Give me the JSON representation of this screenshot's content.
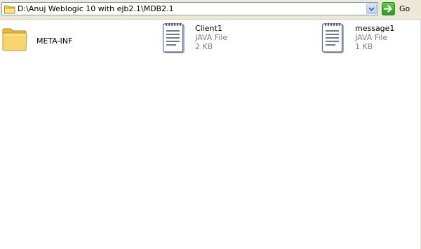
{
  "address_bar": {
    "path": "D:\\Anuj Weblogic 10 with ejb2.1\\MDB2.1",
    "go_label": "Go"
  },
  "items": [
    {
      "name": "META-INF",
      "icon": "folder-icon"
    },
    {
      "name": "Client1",
      "type": "JAVA File",
      "size": "2 KB",
      "icon": "java-file-icon"
    },
    {
      "name": "message1",
      "type": "JAVA File",
      "size": "1 KB",
      "icon": "java-file-icon"
    }
  ],
  "colors": {
    "folder_yellow": "#f5d86a",
    "address_border": "#7f9db9",
    "go_green": "#3aad28",
    "secondary_text": "#808080"
  }
}
